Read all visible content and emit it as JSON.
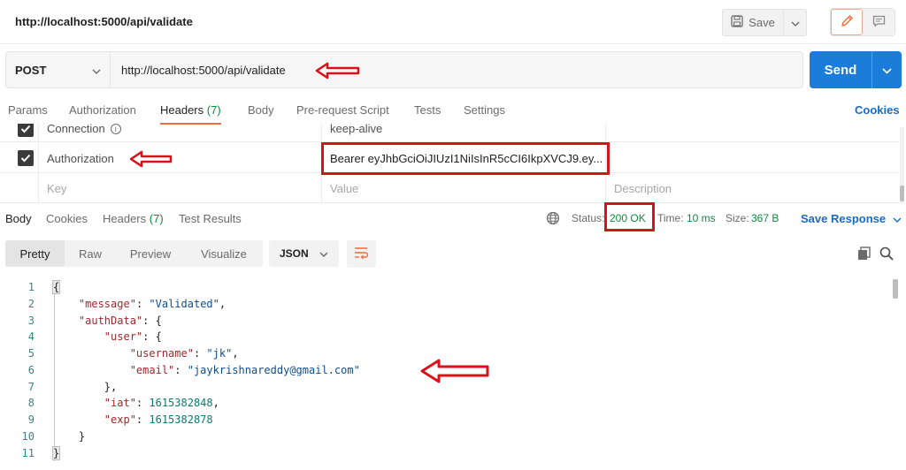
{
  "request": {
    "title": "http://localhost:5000/api/validate",
    "method": "POST",
    "url": "http://localhost:5000/api/validate",
    "save_label": "Save",
    "send_label": "Send"
  },
  "request_tabs": {
    "params": "Params",
    "authorization": "Authorization",
    "headers": "Headers",
    "headers_count": "(7)",
    "body": "Body",
    "prerequest": "Pre-request Script",
    "tests": "Tests",
    "settings": "Settings",
    "cookies": "Cookies"
  },
  "headers_table": {
    "rows": [
      {
        "key": "Connection",
        "value": "keep-alive",
        "checked": true
      },
      {
        "key": "Authorization",
        "value": "Bearer eyJhbGciOiJIUzI1NiIsInR5cCI6IkpXVCJ9.ey...",
        "checked": true
      }
    ],
    "placeholder_key": "Key",
    "placeholder_value": "Value",
    "placeholder_description": "Description"
  },
  "response_tabs": {
    "body": "Body",
    "cookies": "Cookies",
    "headers": "Headers",
    "headers_count": "(7)",
    "test_results": "Test Results",
    "status_label": "Status:",
    "status_value": "200 OK",
    "time_label": "Time:",
    "time_value": "10 ms",
    "size_label": "Size:",
    "size_value": "367 B",
    "save_response": "Save Response"
  },
  "view_modes": {
    "pretty": "Pretty",
    "raw": "Raw",
    "preview": "Preview",
    "visualize": "Visualize",
    "language": "JSON"
  },
  "code": {
    "line_numbers": [
      "1",
      "2",
      "3",
      "4",
      "5",
      "6",
      "7",
      "8",
      "9",
      "10",
      "11"
    ],
    "open_brace": "{",
    "close_brace": "}",
    "message_key": "\"message\"",
    "message_value": "\"Validated\"",
    "authdata_key": "\"authData\"",
    "user_key": "\"user\"",
    "username_key": "\"username\"",
    "username_value": "\"jk\"",
    "email_key": "\"email\"",
    "email_value": "\"jaykrishnareddy@gmail.com\"",
    "iat_key": "\"iat\"",
    "iat_value": "1615382848",
    "exp_key": "\"exp\"",
    "exp_value": "1615382878"
  },
  "colors": {
    "send": "#1b7cd9",
    "accent_tab": "#f26b3a",
    "status_ok": "#0c8a3b",
    "annotation": "#d9121a"
  },
  "icons": [
    "save-icon",
    "chevron-down-icon",
    "pencil-icon",
    "comment-icon",
    "checkmark-icon",
    "info-icon",
    "globe-icon",
    "wrap-lines-icon",
    "copy-icon",
    "search-icon"
  ]
}
